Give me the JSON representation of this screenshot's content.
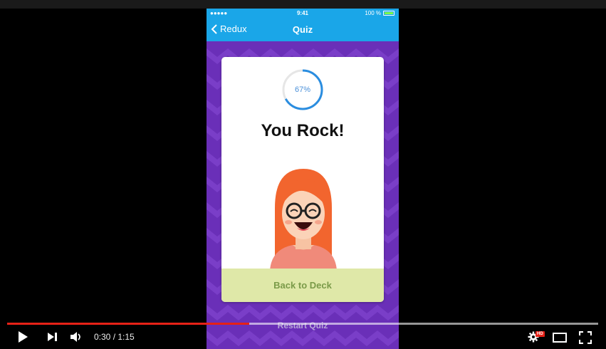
{
  "statusbar": {
    "signal": "●●●●● ",
    "time": "9:41",
    "battery_text": "100 %"
  },
  "navbar": {
    "back_label": "Redux",
    "title": "Quiz"
  },
  "result": {
    "percent": 67,
    "percent_label": "67%",
    "headline": "You Rock!"
  },
  "actions": {
    "back_to_deck": "Back to Deck",
    "restart_quiz": "Restart Quiz"
  },
  "player": {
    "time_label": "0:30 / 1:15",
    "played_fraction": 0.41,
    "loaded_fraction": 1.0,
    "hd_badge": "HD",
    "colors": {
      "played": "#e62117",
      "navbar": "#1aa6e8",
      "background": "#6a2fb8"
    }
  }
}
